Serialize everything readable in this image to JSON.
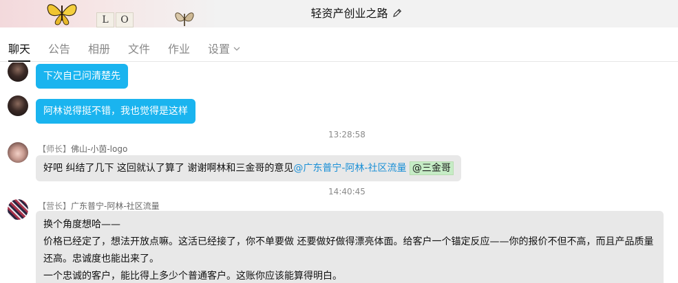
{
  "header": {
    "title": "轻资产创业之路",
    "banner_letters": [
      "L",
      "O"
    ],
    "edit_icon": "pencil-icon"
  },
  "tabs": [
    {
      "label": "聊天",
      "active": true
    },
    {
      "label": "公告",
      "active": false
    },
    {
      "label": "相册",
      "active": false
    },
    {
      "label": "文件",
      "active": false
    },
    {
      "label": "作业",
      "active": false
    },
    {
      "label": "设置",
      "active": false,
      "icon": "chevron-down-icon"
    }
  ],
  "messages": {
    "out_1": {
      "text": "下次自己问清楚先"
    },
    "out_2": {
      "text": "阿林说得挺不错，我也觉得是这样"
    },
    "time_1": "13:28:58",
    "in_1": {
      "role": "【师长】",
      "name": "佛山-小茵-logo",
      "text": "好吧  纠结了几下   这回就认了算了  谢谢啊林和三金哥的意见",
      "link": "@广东普宁-阿林-社区流量",
      "mention": "@三金哥"
    },
    "time_2": "14:40:45",
    "in_2": {
      "role": "【营长】",
      "name": "广东普宁-阿林-社区流量",
      "lines": [
        "换个角度想哈——",
        "价格已经定了，想法开放点嘛。这活已经接了，你不单要做 还要做好做得漂亮体面。给客户一个锚定反应——你的报价不但不高，而且产品质量还高。忠诚度也能出来了。",
        "一个忠诚的客户，能比得上多少个普通客户。这账你应该能算得明白。"
      ]
    }
  },
  "colors": {
    "outgoing_bubble": "#1ab4ef",
    "incoming_bubble": "#e8e8e8",
    "link": "#1a8fd6",
    "mention_bg": "#c6ecc6"
  }
}
